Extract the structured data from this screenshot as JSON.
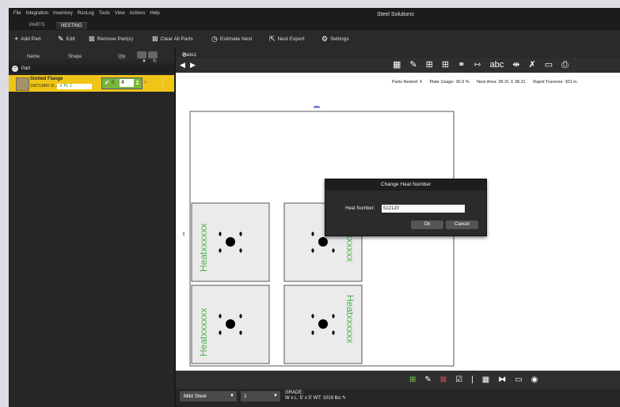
{
  "app": {
    "title": "Steel Solutions",
    "menu": [
      "File",
      "Integration",
      "Inventory",
      "RunLog",
      "Tools",
      "View",
      "Actions",
      "Help"
    ],
    "mode_tabs": [
      "PARTS",
      "NESTING"
    ]
  },
  "toolbar": {
    "add_part": "Add Part",
    "edit": "Edit",
    "remove_parts": "Remove Part(s)",
    "clear_all_parts": "Clear All Parts",
    "estimate_nest": "Estimate Nest",
    "nest_export": "Nest Export",
    "settings": "Settings"
  },
  "parts_panel": {
    "columns": [
      "Name",
      "Shape",
      "Qty"
    ],
    "group_label": "Part",
    "part": {
      "name": "Slotted Flange",
      "id": "100713467-D...",
      "shape": "PL 1",
      "nested_count": "0",
      "qty": "4"
    }
  },
  "plate": {
    "tab_label": "Plate1 #1",
    "stats": {
      "parts_nested": "Parts Nested: 4",
      "plate_usage": "Plate Usage: 36.9 %",
      "nest_area": "Nest Area: 38.31 X 38.31",
      "rapid_traverse": "Rapid Traverse: 301 in."
    },
    "part_label": "Heatxxxxxx"
  },
  "dialog": {
    "title": "Change Heat Number",
    "label": "Heat Number:",
    "value": "522120",
    "ok": "Ok",
    "cancel": "Cancel"
  },
  "footer": {
    "material": "Mild Steel",
    "sheet_qty": "1",
    "grade_label": "GRADE:",
    "dimensions": "W x L: 5' x 5'",
    "weight": "WT: 1019 lbs"
  }
}
